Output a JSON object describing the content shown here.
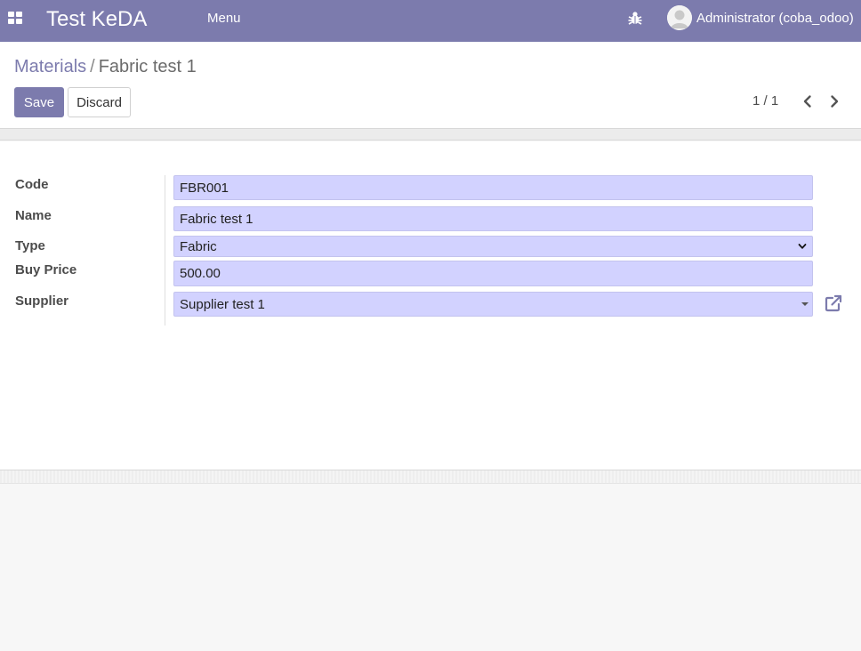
{
  "navbar": {
    "brand": "Test KeDA",
    "menu_label": "Menu",
    "user_name": "Administrator (coba_odoo)",
    "color": "#7c7bad"
  },
  "breadcrumb": {
    "parent": "Materials",
    "separator": "/",
    "current": "Fabric test 1"
  },
  "toolbar": {
    "save_label": "Save",
    "discard_label": "Discard"
  },
  "pager": {
    "value": "1 / 1"
  },
  "form": {
    "fields": {
      "code": {
        "label": "Code",
        "value": "FBR001"
      },
      "name": {
        "label": "Name",
        "value": "Fabric test 1"
      },
      "type": {
        "label": "Type",
        "value": "Fabric"
      },
      "buy_price": {
        "label": "Buy Price",
        "value": "500.00"
      },
      "supplier": {
        "label": "Supplier",
        "value": "Supplier test 1"
      }
    },
    "input_color": "#d2d2ff"
  },
  "icons": {
    "apps": "apps-grid-icon",
    "debug": "bug-icon",
    "avatar": "user-avatar-icon",
    "prev": "chevron-left-icon",
    "next": "chevron-right-icon",
    "type_dropdown": "chevron-down-icon",
    "supplier_dropdown": "caret-down-icon",
    "external": "external-link-icon"
  }
}
